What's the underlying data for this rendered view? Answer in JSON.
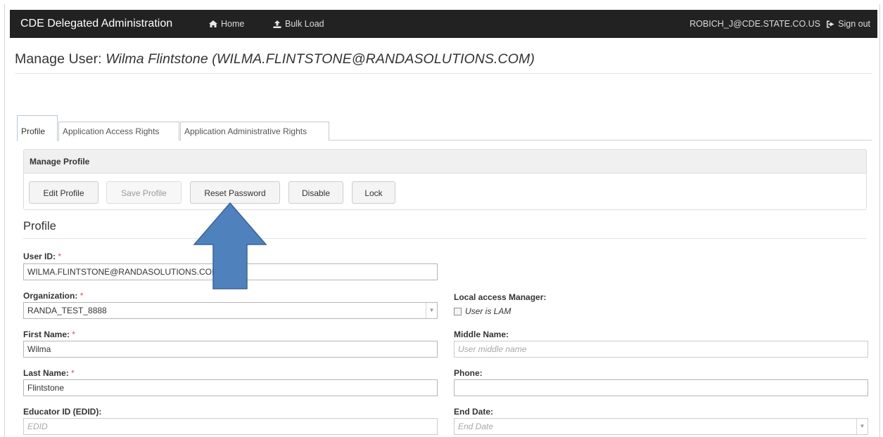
{
  "navbar": {
    "brand": "CDE Delegated Administration",
    "home_label": "Home",
    "bulk_label": "Bulk Load",
    "user_label": "ROBICH_J@CDE.STATE.CO.US",
    "signout_label": "Sign out",
    "bg_color": "#222222"
  },
  "page": {
    "title_prefix": "Manage User:",
    "title_user": "Wilma Flintstone (WILMA.FLINTSTONE@RANDASOLUTIONS.COM)"
  },
  "tabs": [
    {
      "label": "Profile",
      "active": true
    },
    {
      "label": "Application Access Rights",
      "active": false
    },
    {
      "label": "Application Administrative Rights",
      "active": false
    }
  ],
  "manage_panel": {
    "heading": "Manage Profile",
    "buttons": {
      "edit": "Edit Profile",
      "save": "Save Profile",
      "reset": "Reset Password",
      "disable": "Disable",
      "lock": "Lock"
    }
  },
  "profile": {
    "section_title": "Profile",
    "required_marker": "*",
    "user_id": {
      "label": "User ID:",
      "value": "WILMA.FLINTSTONE@RANDASOLUTIONS.COM"
    },
    "organization": {
      "label": "Organization:",
      "value": "RANDA_TEST_8888"
    },
    "lam": {
      "label": "Local access Manager:",
      "checkbox_label": "User is LAM",
      "checked": false
    },
    "first_name": {
      "label": "First Name:",
      "value": "Wilma"
    },
    "middle_name": {
      "label": "Middle Name:",
      "placeholder": "User middle name"
    },
    "last_name": {
      "label": "Last Name:",
      "value": "Flintstone"
    },
    "phone": {
      "label": "Phone:",
      "value": ""
    },
    "edid": {
      "label": "Educator ID (EDID):",
      "placeholder": "EDID"
    },
    "end_date": {
      "label": "End Date:",
      "placeholder": "End Date"
    }
  },
  "annotation": {
    "arrow_color": "#4f81bd",
    "arrow_target": "Reset Password"
  }
}
